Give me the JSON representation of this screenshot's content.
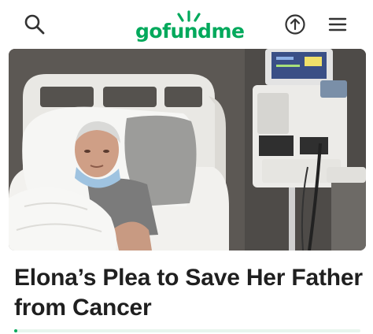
{
  "header": {
    "brand": "gofundme",
    "icons": [
      "search-icon",
      "share-icon",
      "menu-icon"
    ]
  },
  "hero": {
    "image": "photo-elderly-man-in-hospital-bed",
    "colors": {
      "wall": "#5a5652",
      "bed_white": "#eeeeec",
      "monitor_screen": "#3a4f86"
    }
  },
  "campaign": {
    "title": "Elona’s Plea to Save Her Father from Cancer",
    "progress_fraction": 0.01
  },
  "colors": {
    "brand": "#02a95c",
    "text": "#1f1f1f"
  }
}
